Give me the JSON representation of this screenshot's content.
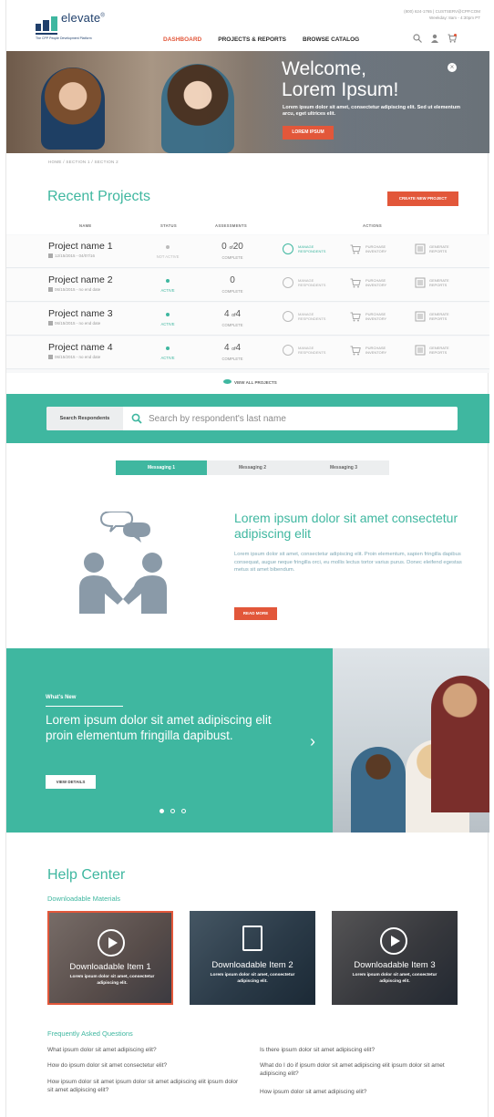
{
  "header": {
    "logo_name": "elevate",
    "logo_tagline": "The CPP People Development Platform",
    "phone": "(800) 624-1765 | CUSTSERV@CPP.COM",
    "hours": "Weekday: 8am - 4:30pm PT",
    "nav": [
      "DASHBOARD",
      "PROJECTS & REPORTS",
      "BROWSE CATALOG"
    ]
  },
  "hero": {
    "title_line1": "Welcome,",
    "title_line2": "Lorem Ipsum!",
    "text": "Lorem ipsum dolor sit amet, consectetur adipiscing elit. Sed ut elementum arcu, eget ultrices elit.",
    "button": "LOREM IPSUM"
  },
  "breadcrumb": "HOME  /  SECTION 1  /  SECTION 2",
  "recent_projects": {
    "title": "Recent Projects",
    "new_button": "CREATE NEW PROJECT",
    "headers": [
      "NAME",
      "STATUS",
      "ASSESSMENTS",
      "ACTIONS"
    ],
    "projects": [
      {
        "name": "Project name 1",
        "date": "12/15/2015 - 04/07/16",
        "status": "NOT ACTIVE",
        "count": "0",
        "of": "of",
        "total": "20",
        "assess_label": "COMPLETE",
        "status_color": "#bbbbbb",
        "manage_active": true
      },
      {
        "name": "Project name 2",
        "date": "06/15/2015 - no end date",
        "status": "ACTIVE",
        "count": "0",
        "of": "",
        "total": "",
        "assess_label": "COMPLETE",
        "status_color": "#3fb7a0",
        "manage_active": false
      },
      {
        "name": "Project name 3",
        "date": "06/15/2015 - no end date",
        "status": "ACTIVE",
        "count": "4",
        "of": "of",
        "total": "4",
        "assess_label": "COMPLETE",
        "status_color": "#3fb7a0",
        "manage_active": false
      },
      {
        "name": "Project name 4",
        "date": "06/15/2015 - no end date",
        "status": "ACTIVE",
        "count": "4",
        "of": "of",
        "total": "4",
        "assess_label": "COMPLETE",
        "status_color": "#3fb7a0",
        "manage_active": false
      }
    ],
    "actions": {
      "manage_1": "MANAGE",
      "manage_2": "RESPONDENTS",
      "purchase_1": "PURCHASE",
      "purchase_2": "INVENTORY",
      "generate_1": "GENERATE",
      "generate_2": "REPORTS"
    },
    "view_all": "VIEW ALL PROJECTS"
  },
  "search": {
    "label": "Search Respondents",
    "placeholder": "Search by respondent's last name"
  },
  "messaging": {
    "tabs": [
      "Messaging 1",
      "Messaging 2",
      "Messaging 3"
    ],
    "title": "Lorem ipsum dolor sit amet consectetur adipiscing elit",
    "text": "Lorem ipsum dolor sit amet, consectetur adipiscing elit. Proin elementum, sapien fringilla dapibus consequat, augue neque fringilla orci, eu mollis lectus tortor varius purus. Donec eleifend egestas metus sit amet bibendum.",
    "button": "READ MORE"
  },
  "whats_new": {
    "label": "What's New",
    "title": "Lorem ipsum dolor sit amet adipiscing elit proin elementum fringilla dapibust.",
    "button": "VIEW DETAILS"
  },
  "help_center": {
    "title": "Help Center",
    "subtitle": "Downloadable Materials",
    "cards": [
      {
        "title": "Downloadable Item 1",
        "text": "Lorem ipsum dolor sit amet, consectetur adipiscing elit."
      },
      {
        "title": "Downloadable Item 2",
        "text": "Lorem ipsum dolor sit amet, consectetur adipiscing elit."
      },
      {
        "title": "Downloadable Item 3",
        "text": "Lorem ipsum dolor sit amet, consectetur adipiscing elit."
      }
    ],
    "faq_title": "Frequently Asked Questions",
    "faq": [
      "What ipsum dolor sit amet  adipiscing elit?",
      "How do ipsum dolor sit amet consectetur elit?",
      "How ipsum dolor sit amet ipsum dolor sit amet adipiscing elit ipsum dolor sit amet adipiscing elit?",
      "Is there ipsum dolor sit amet  adipiscing elit?",
      "What do I do if ipsum dolor sit amet  adipiscing elit ipsum dolor sit amet adipiscing elit?",
      "How ipsum dolor sit amet  adipiscing elit?"
    ]
  },
  "colors": {
    "accent": "#3fb7a0",
    "cta": "#e2573a",
    "brand": "#1f3f6b"
  }
}
